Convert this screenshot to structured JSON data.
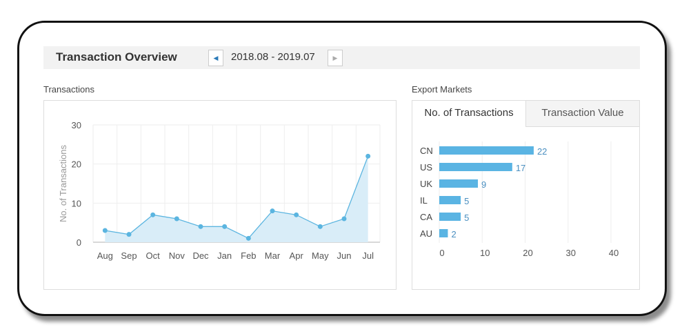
{
  "header": {
    "title": "Transaction Overview",
    "date_range": "2018.08 - 2019.07",
    "prev_icon": "triangle-left",
    "next_icon": "triangle-right"
  },
  "left": {
    "label": "Transactions"
  },
  "right": {
    "label": "Export Markets",
    "tabs": [
      {
        "label": "No. of Transactions",
        "active": true
      },
      {
        "label": "Transaction Value",
        "active": false
      }
    ]
  },
  "colors": {
    "accent": "#5bb5e0",
    "fill": "#d9edf8",
    "bar": "#5ab4e3"
  },
  "chart_data": [
    {
      "type": "area",
      "title": "Transactions",
      "xlabel": "",
      "ylabel": "No. of Transactions",
      "ylim": [
        0,
        30
      ],
      "yticks": [
        0,
        10,
        20,
        30
      ],
      "categories": [
        "Aug",
        "Sep",
        "Oct",
        "Nov",
        "Dec",
        "Jan",
        "Feb",
        "Mar",
        "Apr",
        "May",
        "Jun",
        "Jul"
      ],
      "values": [
        3,
        2,
        7,
        6,
        4,
        4,
        1,
        8,
        7,
        4,
        6,
        22
      ],
      "grid": true
    },
    {
      "type": "bar",
      "orientation": "horizontal",
      "title": "No. of Transactions",
      "categories": [
        "CN",
        "US",
        "UK",
        "IL",
        "CA",
        "AU"
      ],
      "values": [
        22,
        17,
        9,
        5,
        5,
        2
      ],
      "xlim": [
        0,
        40
      ],
      "xticks": [
        0,
        10,
        20,
        30,
        40
      ],
      "grid": true,
      "data_labels": true
    }
  ]
}
